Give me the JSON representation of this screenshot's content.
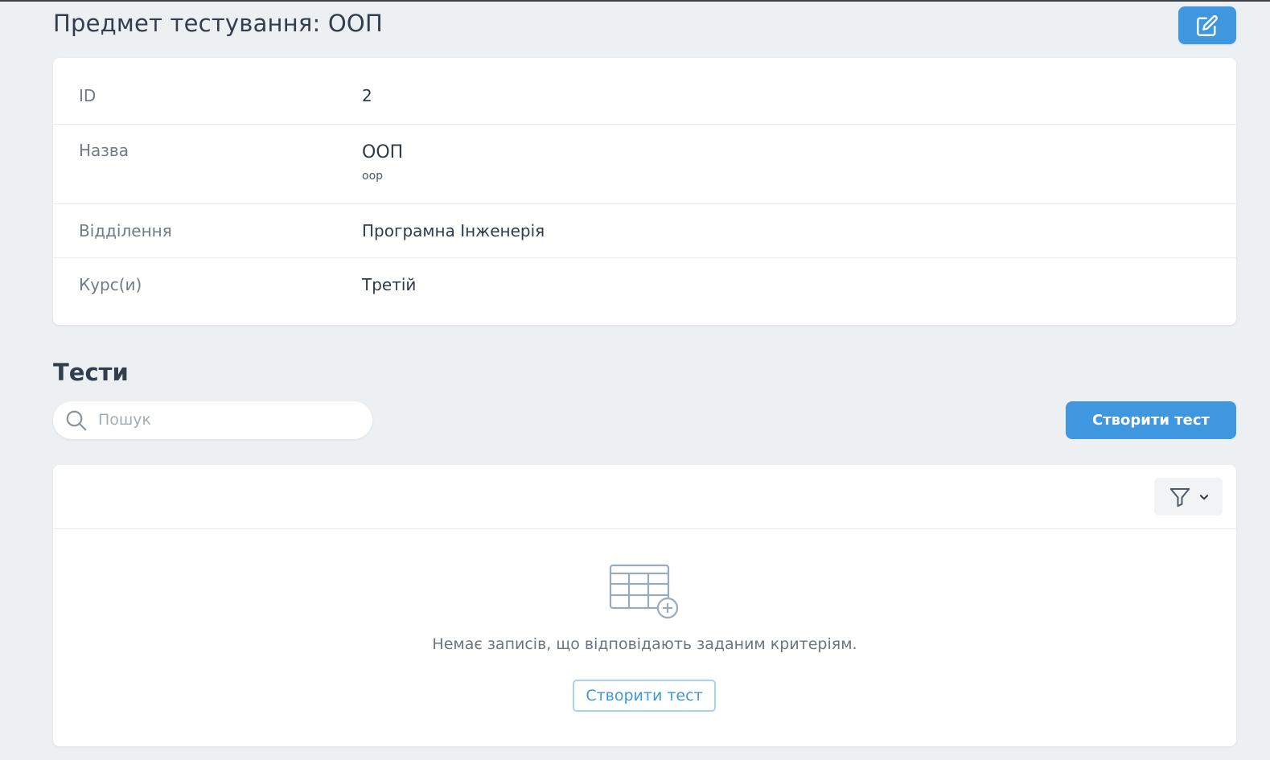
{
  "page": {
    "title": "Предмет тестування: ООП"
  },
  "details": {
    "rows": [
      {
        "label": "ID",
        "value": "2"
      },
      {
        "label": "Назва",
        "value": "ООП",
        "sub": "oop"
      },
      {
        "label": "Відділення",
        "value": "Програмна Інженерія"
      },
      {
        "label": "Курс(и)",
        "value": "Третій"
      }
    ]
  },
  "tests": {
    "title": "Тести",
    "search_placeholder": "Пошук",
    "create_label": "Створити тест",
    "empty_text": "Немає записів, що відповідають заданим критеріям.",
    "empty_create_label": "Створити тест"
  },
  "icons": {
    "edit": "edit-icon",
    "search": "search-icon",
    "filter": "filter-icon",
    "chevron": "chevron-down-icon",
    "empty": "table-add-icon"
  },
  "colors": {
    "accent": "#3f97df",
    "background": "#edf0f3",
    "card": "#ffffff"
  }
}
